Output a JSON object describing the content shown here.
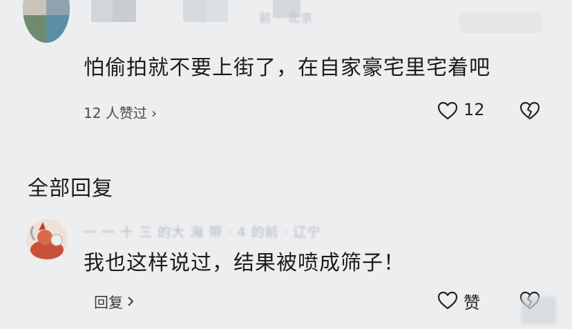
{
  "top_comment": {
    "meta_text": "前 · 北京",
    "text": "怕偷拍就不要上街了，在自家豪宅里宅着吧",
    "likes_link": "12 人赞过 ›",
    "like_count": "12",
    "icons": {
      "like": "heart-icon",
      "dislike": "broken-heart-icon"
    }
  },
  "replies_section": {
    "title": "全部回复"
  },
  "reply": {
    "meta_text": "一 一 十 三 的大 海 带 · 4 的前 · 辽宁",
    "text": "我也这样说过，结果被喷成筛子！",
    "reply_label": "回复",
    "like_label": "赞",
    "icons": {
      "reply_chevron": "chevron-right-icon",
      "like": "heart-icon",
      "dislike": "broken-heart-icon"
    }
  },
  "colors": {
    "background": "#eceef0",
    "text": "#1b1b1b",
    "secondary_text": "#4a4a4a"
  }
}
